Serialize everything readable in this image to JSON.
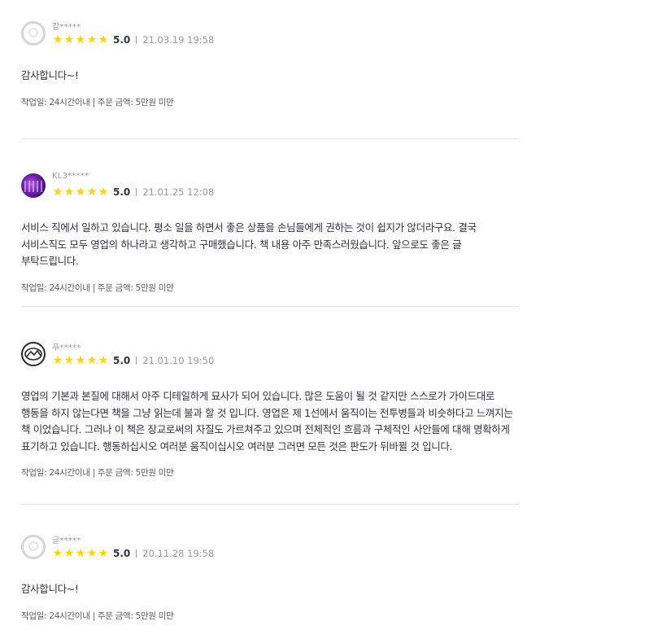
{
  "reviews": [
    {
      "username": "감*****",
      "avatar": "default-avatar",
      "stars": 5,
      "score": "5.0",
      "date": "21.03.19 19:58",
      "body": "감사합니다~!",
      "meta": "작업일: 24시간이내 | 주문 금액: 5만원 미만"
    },
    {
      "username": "KL3*****",
      "avatar": "photo-avatar",
      "stars": 5,
      "score": "5.0",
      "date": "21.01.25 12:08",
      "body": "서비스 직에서 일하고 있습니다. 평소 일을 하면서 좋은 상품을 손님들에게 권하는 것이 쉽지가 않더라구요. 결국 서비스직도 모두 영업의 하나라고 생각하고 구매했습니다. 책 내용 아주 만족스러웠습니다. 앞으로도 좋은 글 부탁드립니다.",
      "meta": "작업일: 24시간이내 | 주문 금액: 5만원 미만"
    },
    {
      "username": "푸*****",
      "avatar": "logo-avatar",
      "stars": 5,
      "score": "5.0",
      "date": "21.01.10 19:50",
      "body": "영업의 기본과 본질에 대해서 아주 디테일하게 묘사가 되어 있습니다. 많은 도움이 될 것 같지만 스스로가 가이드대로 행동을 하지 않는다면 책을 그냥 읽는데 불과 할 것 입니다. 영업은 제 1선에서 움직이는 전투병들과 비슷하다고 느껴지는 책 이었습니다. 그러나 이 책은 장교로써의 자질도 가르쳐주고 있으며 전체적인 흐름과 구체적인 사안들에 대해 명확하게 표기하고 있습니다. 행동하십시오 여러분 움직이십시오 여러분 그러면 모든 것은 판도가 뒤바뀔 것 입니다.",
      "meta": "작업일: 24시간이내 | 주문 금액: 5만원 미만"
    },
    {
      "username": "글*****",
      "avatar": "default-avatar",
      "stars": 5,
      "score": "5.0",
      "date": "20.11.28 19:58",
      "body": "감사합니다~!",
      "meta": "작업일: 24시간이내 | 주문 금액: 5만원 미만"
    }
  ],
  "colors": {
    "star": "#ffd400",
    "text": "#303441",
    "muted": "#9a9ba1",
    "divider": "#e4e5ed"
  },
  "icons": {
    "star": "star-icon",
    "separator": "separator-bar"
  }
}
